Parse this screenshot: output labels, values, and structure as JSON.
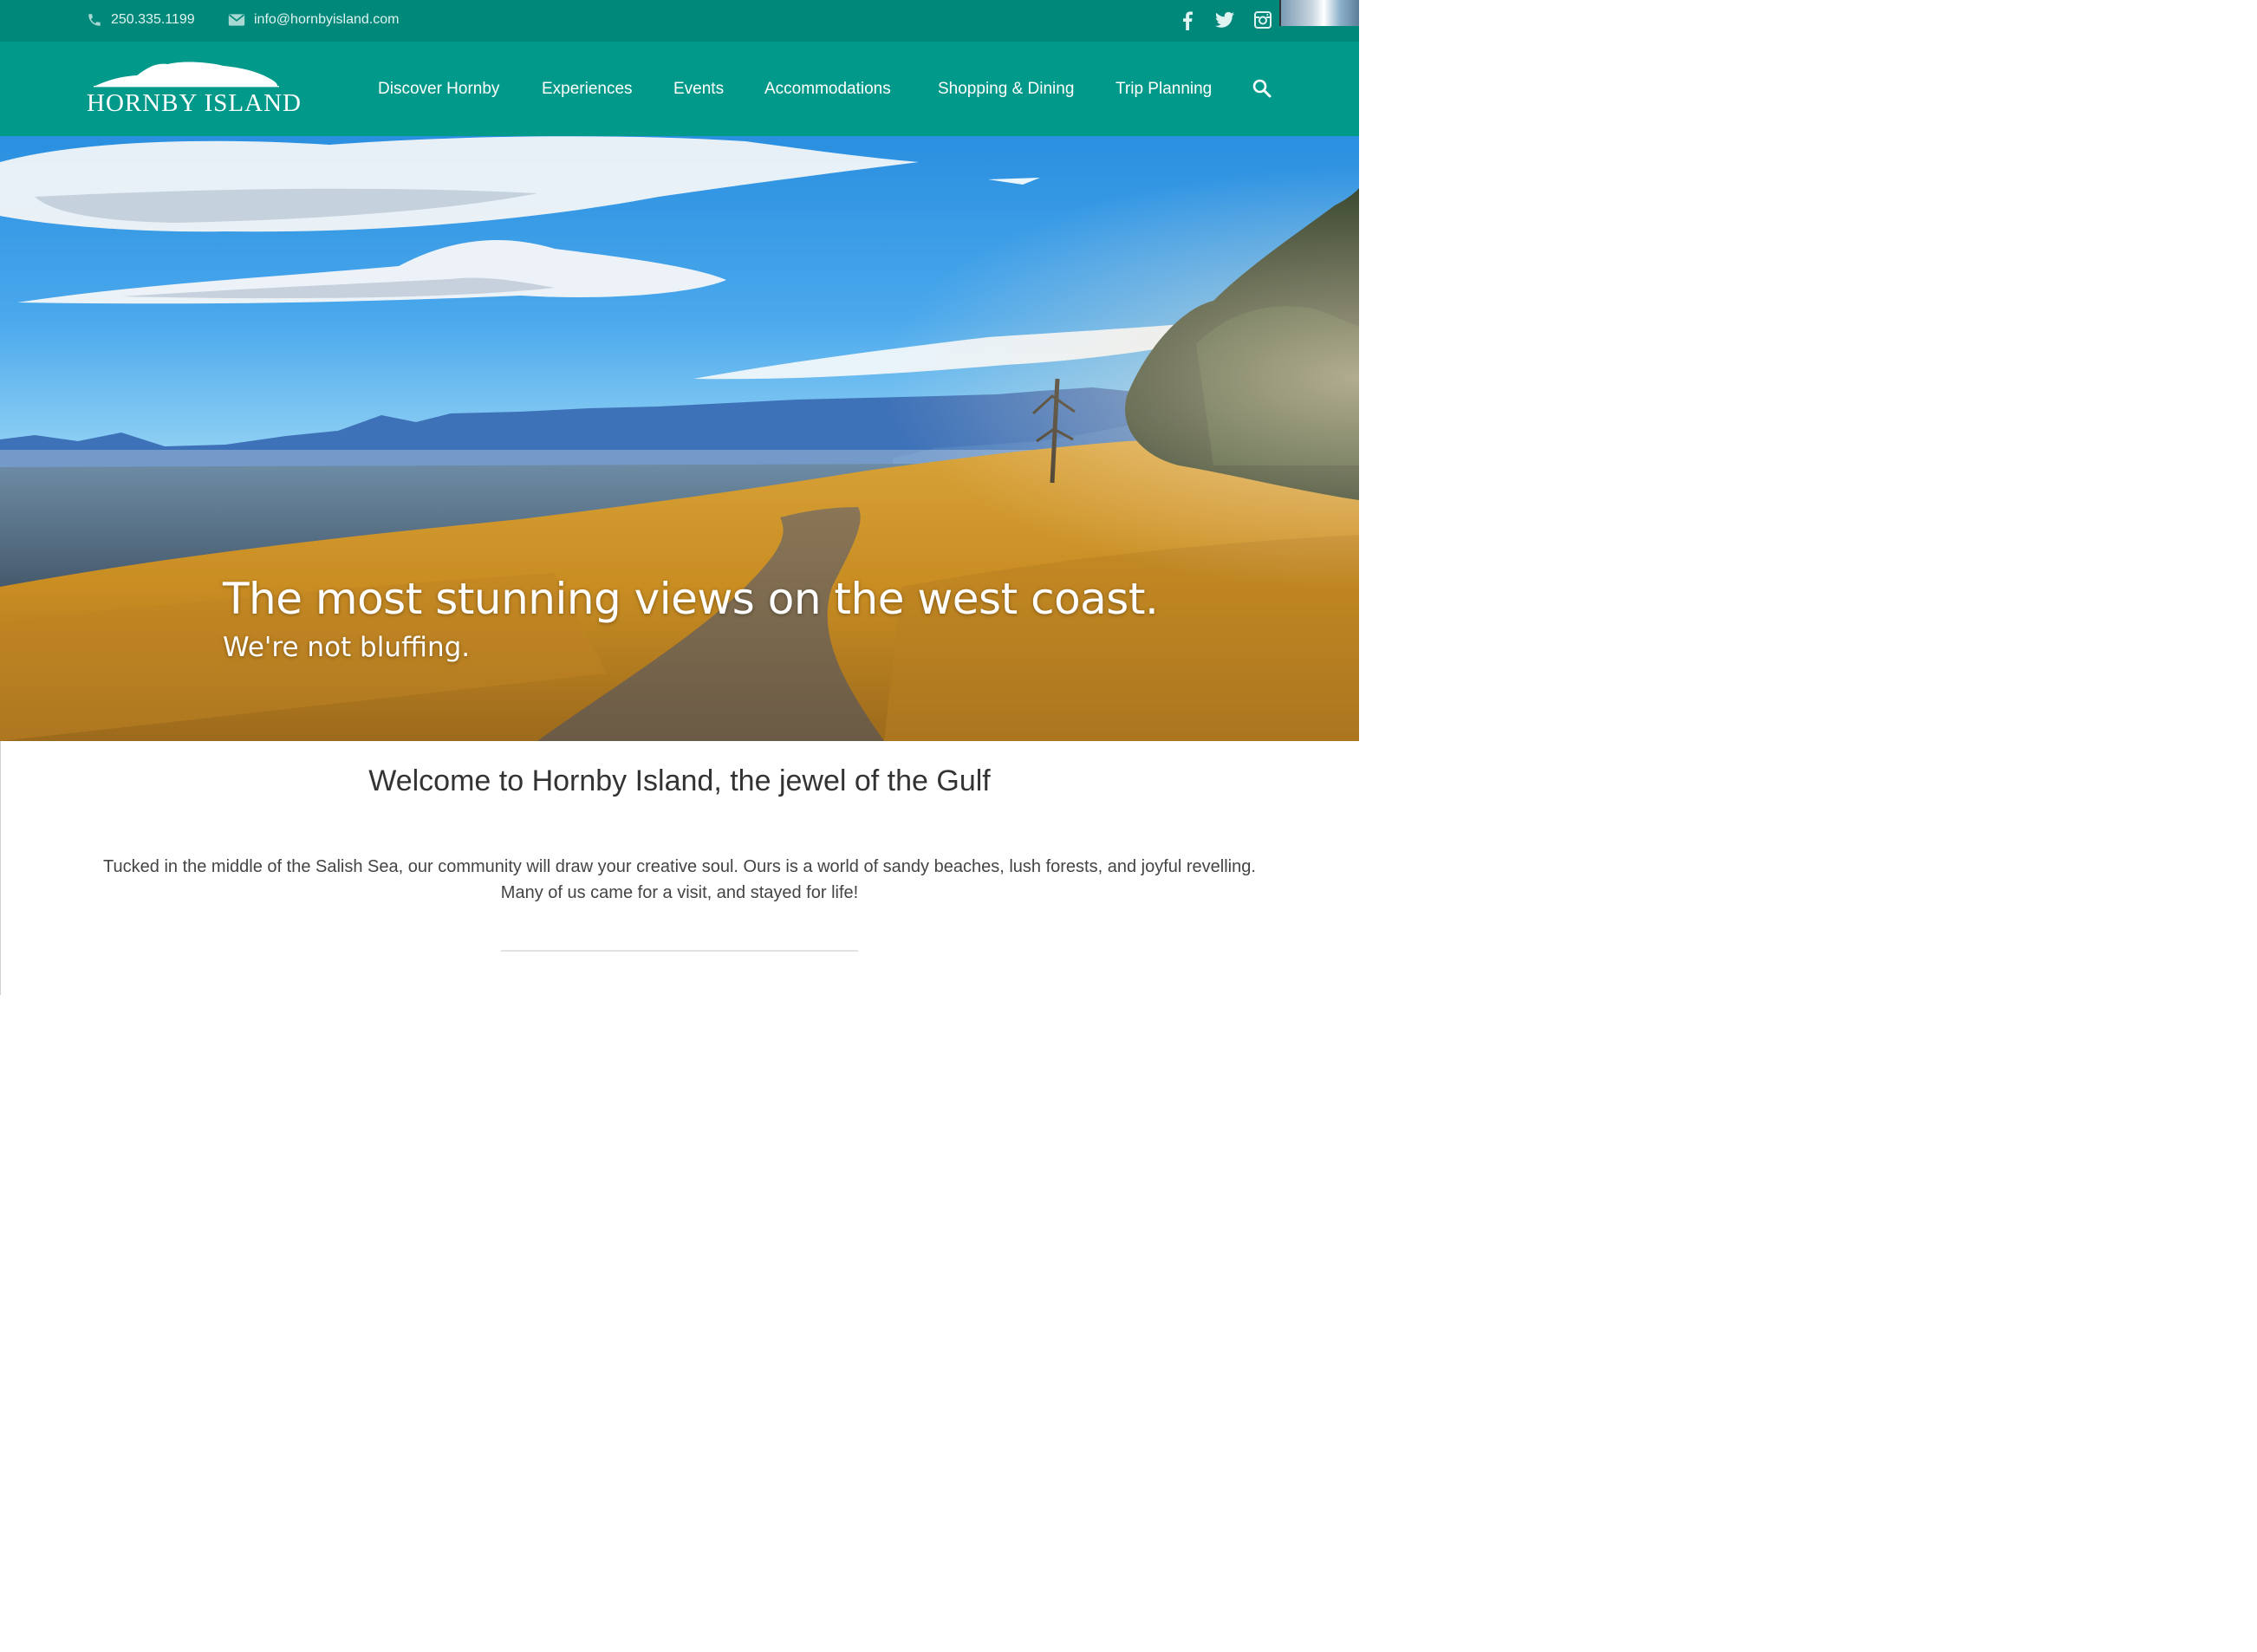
{
  "topbar": {
    "phone": "250.335.1199",
    "email": "info@hornbyisland.com",
    "social": [
      "facebook-icon",
      "twitter-icon",
      "instagram-icon"
    ]
  },
  "nav": {
    "logo_text": "HORNBY ISLAND",
    "items": [
      "Discover Hornby",
      "Experiences",
      "Events",
      "Accommodations",
      "Shopping & Dining",
      "Trip Planning"
    ],
    "search_icon": "search-icon"
  },
  "hero": {
    "headline": "The most stunning views on the west coast.",
    "subheadline": "We're not bluffing."
  },
  "content": {
    "welcome": "Welcome to Hornby Island, the jewel of the Gulf",
    "intro": "Tucked in the middle of the Salish Sea, our community will draw your creative soul. Ours is a world of sandy beaches, lush forests, and joyful revelling. Many of us came for a visit, and stayed for life!"
  },
  "colors": {
    "topbar": "#00897b",
    "navbar": "#00998a",
    "text_dark": "#333333"
  }
}
